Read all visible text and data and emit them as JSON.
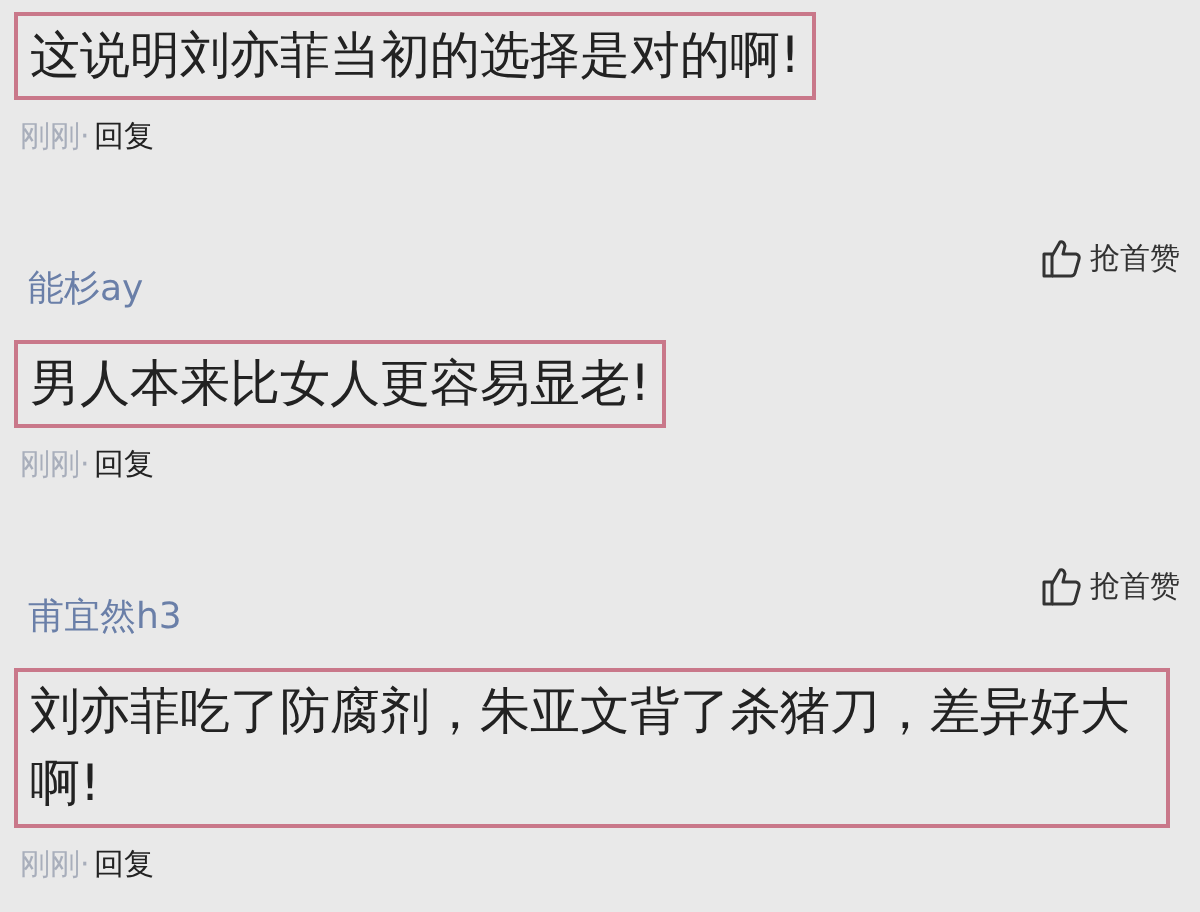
{
  "comments": [
    {
      "text": "这说明刘亦菲当初的选择是对的啊!",
      "time": "刚刚",
      "separator": "·",
      "reply": "回复"
    },
    {
      "author": "能杉ay",
      "like": "抢首赞",
      "text": "男人本来比女人更容易显老!",
      "time": "刚刚",
      "separator": "·",
      "reply": "回复"
    },
    {
      "author": "甫宜然h3",
      "like": "抢首赞",
      "text": "刘亦菲吃了防腐剂，朱亚文背了杀猪刀，差异好大啊!",
      "time": "刚刚",
      "separator": "·",
      "reply": "回复"
    }
  ]
}
